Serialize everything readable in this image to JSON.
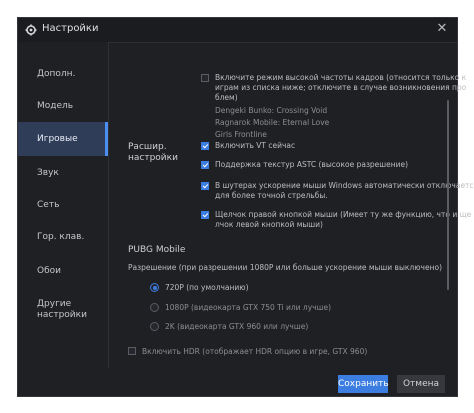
{
  "window": {
    "title": "Настройки"
  },
  "sidebar": {
    "items": [
      {
        "label": "Дополн."
      },
      {
        "label": "Модель"
      },
      {
        "label": "Игровые"
      },
      {
        "label": "Звук"
      },
      {
        "label": "Сеть"
      },
      {
        "label": "Гор. клав."
      },
      {
        "label": "Обои"
      },
      {
        "label": "Другие\nнастройки"
      }
    ],
    "active_index": 2
  },
  "advanced": {
    "label": "Расшир.\nнастройки",
    "high_fps": {
      "checked": false,
      "text_line1": "Включите режим высокой частоты кадров (относится только к",
      "text_line2": "играм из списка ниже; отключите в случае возникновения про",
      "text_line3": "блем)"
    },
    "games": [
      "Dengeki Bunko: Crossing Void",
      "Ragnarok Mobile: Eternal Love",
      "Girls Frontline"
    ],
    "vt": {
      "checked": true,
      "text": "Включить VT сейчас"
    },
    "astc": {
      "checked": true,
      "text": "Поддержка текстур ASTC (высокое разрешение)"
    },
    "mouse_accel": {
      "checked": true,
      "text_line1": "В шутерах ускорение мыши Windows автоматически отключается",
      "text_line2": "для более точной стрельбы."
    },
    "right_click": {
      "checked": true,
      "text_line1": "Щелчок правой кнопкой мыши (Имеет ту же функцию, что и ще",
      "text_line2": "лчок левой кнопкой мыши)"
    }
  },
  "pubg": {
    "title": "PUBG Mobile",
    "resolution_label": "Разрешение (при разрешении 1080P или больше ускорение мыши выключено)",
    "options": [
      {
        "text": "720P (по умолчанию)",
        "selected": true
      },
      {
        "text": "1080P (видеокарта GTX 750 Ti или лучше)",
        "selected": false
      },
      {
        "text": "2K (видеокарта GTX 960 или лучше)",
        "selected": false
      }
    ],
    "hdr": {
      "checked": false,
      "text": "Включить HDR (отображает HDR опцию в игре, GTX 960)"
    }
  },
  "footer": {
    "save_label": "Сохранить",
    "cancel_label": "Отмена"
  },
  "colors": {
    "accent": "#3b7de0",
    "background": "#1f2024",
    "sidebar_active": "#2f3d58"
  }
}
